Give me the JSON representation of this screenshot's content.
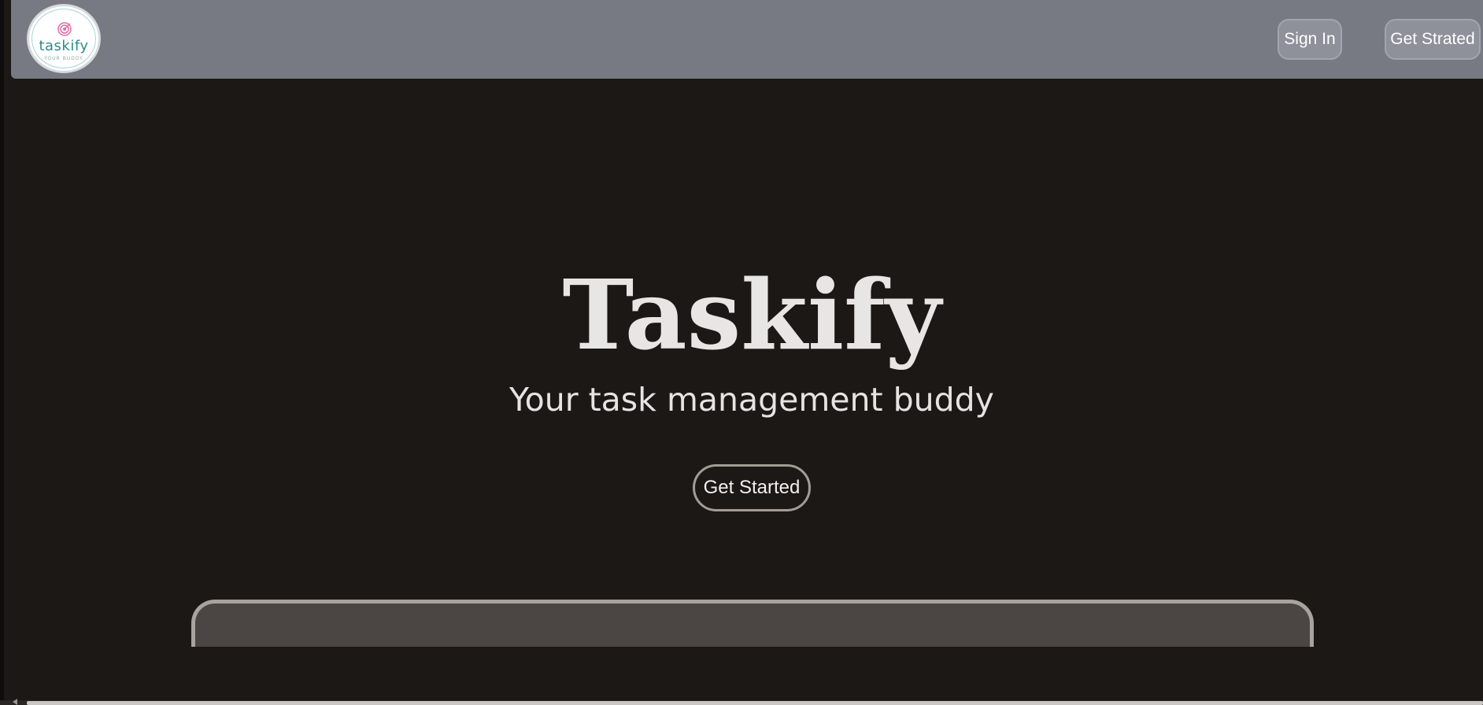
{
  "navbar": {
    "logo": {
      "wordmark": "taskify",
      "tagline": "YOUR BUDDY",
      "icon": "target-icon",
      "accent_color": "#e06aa8",
      "wordmark_color": "#2f8c84"
    },
    "sign_in_label": "Sign In",
    "get_strated_label": "Get Strated",
    "background_color": "#777a82"
  },
  "hero": {
    "title": "Taskify",
    "subtitle": "Your task management buddy",
    "cta_label": "Get Started",
    "background_color": "#1c1816"
  }
}
